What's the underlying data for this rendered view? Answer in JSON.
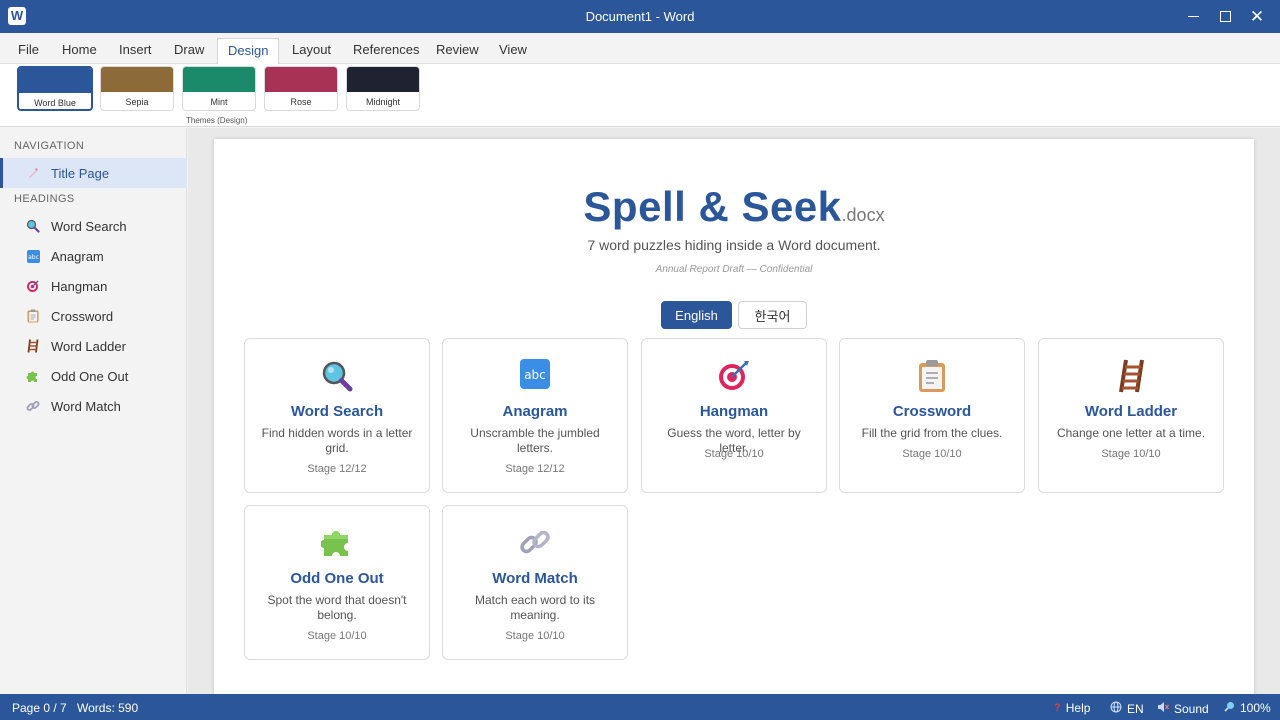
{
  "window": {
    "app_icon": "W",
    "title": "Document1 - Word"
  },
  "menu": {
    "tabs": [
      {
        "label": "File"
      },
      {
        "label": "Home"
      },
      {
        "label": "Insert"
      },
      {
        "label": "Draw"
      },
      {
        "label": "Design",
        "active": true
      },
      {
        "label": "Layout"
      },
      {
        "label": "References"
      },
      {
        "label": "Review"
      },
      {
        "label": "View"
      }
    ]
  },
  "ribbon": {
    "themes": [
      {
        "label": "Word Blue",
        "color": "#2b579a",
        "selected": true
      },
      {
        "label": "Sepia",
        "color": "#8c6b38"
      },
      {
        "label": "Mint",
        "color": "#1a8a6a"
      },
      {
        "label": "Rose",
        "color": "#a83256"
      },
      {
        "label": "Midnight",
        "color": "#1f2230"
      }
    ],
    "group_label": "Themes (Design)"
  },
  "sidebar": {
    "navigation_label": "NAVIGATION",
    "title_page": "Title Page",
    "headings_label": "HEADINGS",
    "items": [
      {
        "label": "Word Search",
        "icon": "magnifier-icon"
      },
      {
        "label": "Anagram",
        "icon": "abc-icon"
      },
      {
        "label": "Hangman",
        "icon": "target-icon"
      },
      {
        "label": "Crossword",
        "icon": "clipboard-icon"
      },
      {
        "label": "Word Ladder",
        "icon": "ladder-icon"
      },
      {
        "label": "Odd One Out",
        "icon": "puzzle-icon"
      },
      {
        "label": "Word Match",
        "icon": "link-icon"
      }
    ]
  },
  "document": {
    "title": "Spell & Seek",
    "extension": ".docx",
    "subtitle": "7 word puzzles hiding inside a Word document.",
    "tagline": "Annual Report Draft — Confidential",
    "languages": [
      {
        "label": "English",
        "active": true
      },
      {
        "label": "한국어"
      }
    ],
    "cards": [
      {
        "name": "Word Search",
        "desc": "Find hidden words in a letter grid.",
        "stage": "Stage 12/12",
        "icon": "magnifier-icon"
      },
      {
        "name": "Anagram",
        "desc": "Unscramble the jumbled letters.",
        "stage": "Stage 12/12",
        "icon": "abc-icon",
        "icon_text": "abc"
      },
      {
        "name": "Hangman",
        "desc": "Guess the word, letter by letter.",
        "stage": "Stage 10/10",
        "icon": "target-icon"
      },
      {
        "name": "Crossword",
        "desc": "Fill the grid from the clues.",
        "stage": "Stage 10/10",
        "icon": "clipboard-icon"
      },
      {
        "name": "Word Ladder",
        "desc": "Change one letter at a time.",
        "stage": "Stage 10/10",
        "icon": "ladder-icon"
      },
      {
        "name": "Odd One Out",
        "desc": "Spot the word that doesn't belong.",
        "stage": "Stage 10/10",
        "icon": "puzzle-icon"
      },
      {
        "name": "Word Match",
        "desc": "Match each word to its meaning.",
        "stage": "Stage 10/10",
        "icon": "link-icon"
      }
    ]
  },
  "status": {
    "page": "Page 0 / 7",
    "words": "Words: 590",
    "help": "Help",
    "language": "EN",
    "sound": "Sound",
    "zoom": "100%"
  },
  "colors": {
    "brand": "#2b579a",
    "highlight": "#dce6f6"
  }
}
